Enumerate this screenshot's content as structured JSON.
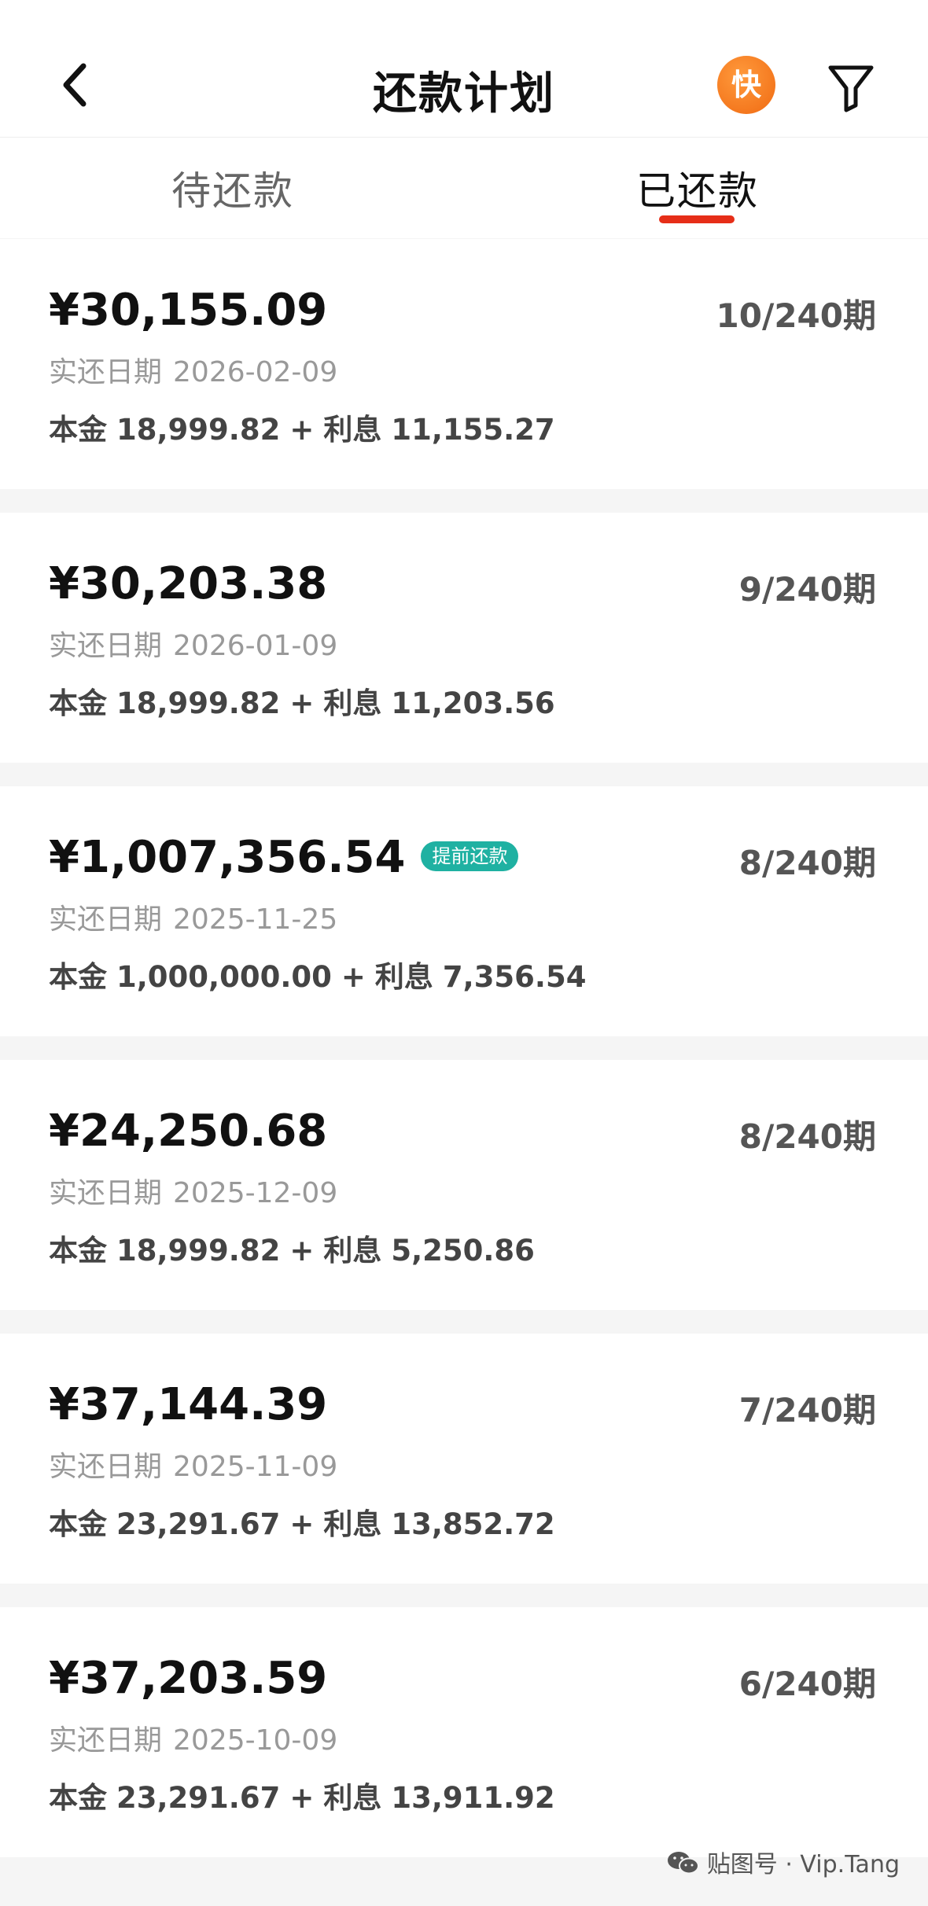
{
  "header": {
    "title": "还款计划",
    "quick_badge": "快"
  },
  "tabs": [
    {
      "label": "待还款",
      "active": false
    },
    {
      "label": "已还款",
      "active": true
    }
  ],
  "colors": {
    "accent_underline": "#e62e18",
    "tag_bg": "#1fb1a2",
    "badge_orange": "#f06a12"
  },
  "labels": {
    "date_label": "实还日期",
    "principal_label": "本金",
    "interest_label": "利息",
    "plus": "+"
  },
  "records": [
    {
      "amount": "¥30,155.09",
      "period": "10/240期",
      "date": "2026-02-09",
      "principal": "18,999.82",
      "interest": "11,155.27",
      "tag": ""
    },
    {
      "amount": "¥30,203.38",
      "period": "9/240期",
      "date": "2026-01-09",
      "principal": "18,999.82",
      "interest": "11,203.56",
      "tag": ""
    },
    {
      "amount": "¥1,007,356.54",
      "period": "8/240期",
      "date": "2025-11-25",
      "principal": "1,000,000.00",
      "interest": "7,356.54",
      "tag": "提前还款"
    },
    {
      "amount": "¥24,250.68",
      "period": "8/240期",
      "date": "2025-12-09",
      "principal": "18,999.82",
      "interest": "5,250.86",
      "tag": ""
    },
    {
      "amount": "¥37,144.39",
      "period": "7/240期",
      "date": "2025-11-09",
      "principal": "23,291.67",
      "interest": "13,852.72",
      "tag": ""
    },
    {
      "amount": "¥37,203.59",
      "period": "6/240期",
      "date": "2025-10-09",
      "principal": "23,291.67",
      "interest": "13,911.92",
      "tag": ""
    }
  ],
  "watermark": {
    "text": "贴图号 · Vip.Tang",
    "icon": "wechat-icon"
  }
}
